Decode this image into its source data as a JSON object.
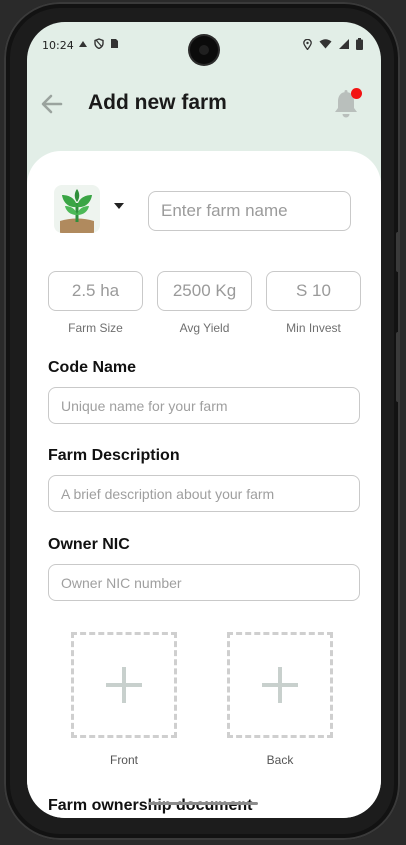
{
  "status": {
    "time": "10:24"
  },
  "header": {
    "title": "Add new farm"
  },
  "form": {
    "farm_name_placeholder": "Enter farm name",
    "stats": [
      {
        "value": "2.5 ha",
        "label": "Farm Size"
      },
      {
        "value": "2500 Kg",
        "label": "Avg Yield"
      },
      {
        "value": "S 10",
        "label": "Min Invest"
      }
    ],
    "code_name": {
      "label": "Code Name",
      "placeholder": "Unique name for your farm"
    },
    "description": {
      "label": "Farm Description",
      "placeholder": "A brief description about your farm"
    },
    "owner_nic": {
      "label": "Owner NIC",
      "placeholder": "Owner NIC number"
    },
    "uploads": [
      {
        "label": "Front"
      },
      {
        "label": "Back"
      }
    ],
    "ownership_document_label": "Farm ownership document"
  },
  "colors": {
    "header_bg": "#e2eee7",
    "notification_dot": "#f21313",
    "plant_green": "#3aa545",
    "soil": "#b08a5e"
  },
  "icons": {
    "back": "arrow-left-icon",
    "notifications": "bell-icon",
    "farm_logo": "sprout-icon",
    "dropdown": "caret-down-icon",
    "upload": "plus-icon"
  }
}
